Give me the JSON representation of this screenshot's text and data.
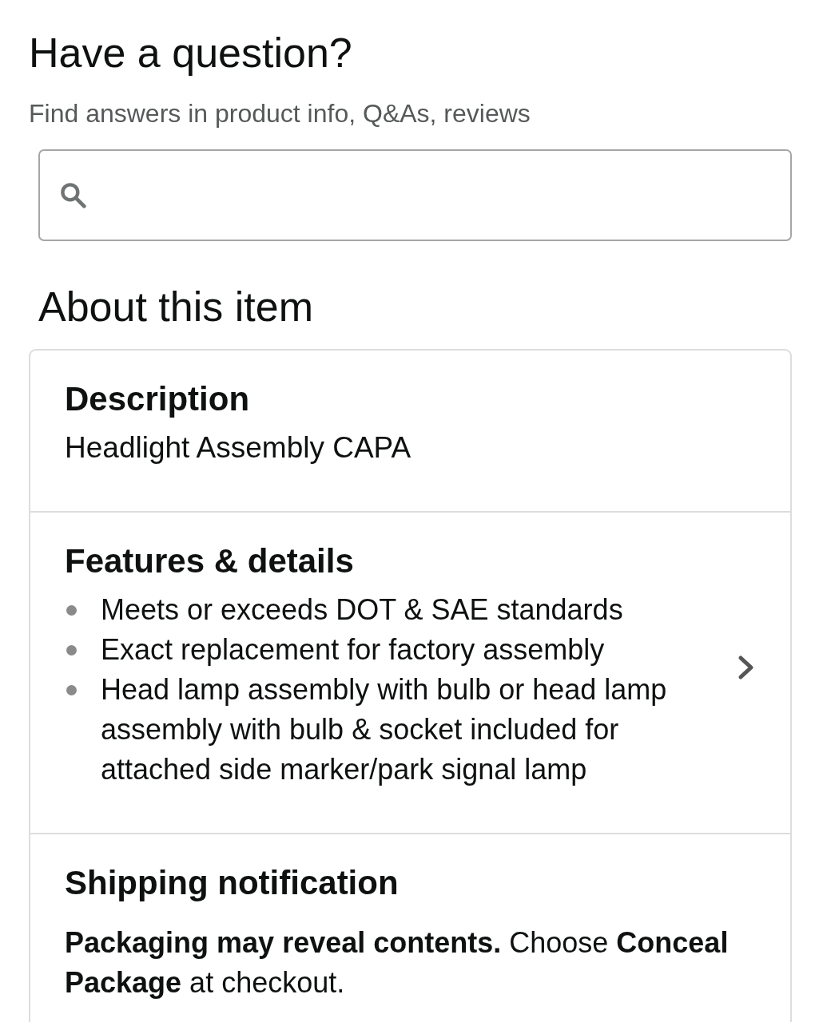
{
  "question": {
    "title": "Have a question?",
    "subtitle": "Find answers in product info, Q&As, reviews"
  },
  "about": {
    "title": "About this item",
    "sections": [
      {
        "kind": "text",
        "title": "Description",
        "text": "Headlight Assembly CAPA",
        "navigable": false
      },
      {
        "kind": "bullets",
        "title": "Features & details",
        "items": [
          "Meets or exceeds DOT & SAE standards",
          "Exact replacement for factory assembly",
          "Head lamp assembly with bulb or head lamp assembly with bulb & socket included for attached side marker/park signal lamp"
        ],
        "navigable": true
      },
      {
        "kind": "notice",
        "title": "Shipping notification",
        "text": "**Packaging may reveal contents.** Choose **Conceal Package** at checkout.",
        "navigable": false
      }
    ]
  }
}
